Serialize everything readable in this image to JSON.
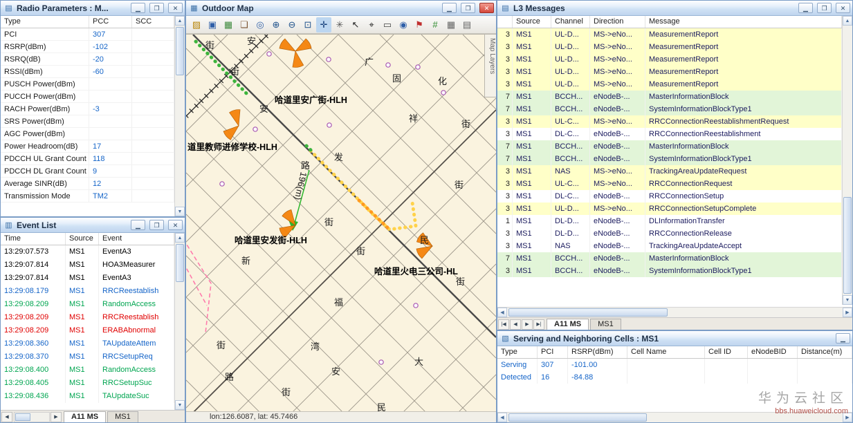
{
  "chrome": {
    "minimize_glyph": "▁",
    "restore_glyph": "❐",
    "close_glyph": "✕",
    "arrow_up": "▲",
    "arrow_down": "▼",
    "arrow_left": "◀",
    "arrow_right": "▶",
    "tab_nav": [
      "|◀",
      "◀",
      "▶",
      "▶|"
    ],
    "icons": {
      "radio": "▤",
      "events": "▥",
      "map": "▦",
      "l3": "▤",
      "serving": "▧"
    }
  },
  "radio": {
    "title": "Radio Parameters : M...",
    "columns": [
      "Type",
      "PCC",
      "SCC"
    ],
    "rows": [
      {
        "type": "PCI",
        "pcc": "307",
        "scc": ""
      },
      {
        "type": "RSRP(dBm)",
        "pcc": "-102",
        "scc": ""
      },
      {
        "type": "RSRQ(dB)",
        "pcc": "-20",
        "scc": ""
      },
      {
        "type": "RSSI(dBm)",
        "pcc": "-60",
        "scc": ""
      },
      {
        "type": "PUSCH Power(dBm)",
        "pcc": "",
        "scc": ""
      },
      {
        "type": "PUCCH Power(dBm)",
        "pcc": "",
        "scc": ""
      },
      {
        "type": "RACH Power(dBm)",
        "pcc": "-3",
        "scc": ""
      },
      {
        "type": "SRS Power(dBm)",
        "pcc": "",
        "scc": ""
      },
      {
        "type": "AGC Power(dBm)",
        "pcc": "",
        "scc": ""
      },
      {
        "type": "Power Headroom(dB)",
        "pcc": "17",
        "scc": ""
      },
      {
        "type": "PDCCH UL Grant Count",
        "pcc": "118",
        "scc": ""
      },
      {
        "type": "PDCCH DL Grant Count",
        "pcc": "9",
        "scc": ""
      },
      {
        "type": "Average SINR(dB)",
        "pcc": "12",
        "scc": ""
      },
      {
        "type": "Transmission Mode",
        "pcc": "TM2",
        "scc": ""
      }
    ]
  },
  "events": {
    "title": "Event List",
    "columns": [
      "Time",
      "Source",
      "Event"
    ],
    "rows": [
      {
        "time": "13:29:07.573",
        "source": "MS1",
        "event": "EventA3",
        "color": "#000000"
      },
      {
        "time": "13:29:07.814",
        "source": "MS1",
        "event": "HOA3Measurer",
        "color": "#000000"
      },
      {
        "time": "13:29:07.814",
        "source": "MS1",
        "event": "EventA3",
        "color": "#000000"
      },
      {
        "time": "13:29:08.179",
        "source": "MS1",
        "event": "RRCReestablish",
        "color": "#1464c8"
      },
      {
        "time": "13:29:08.209",
        "source": "MS1",
        "event": "RandomAccess",
        "color": "#00a550"
      },
      {
        "time": "13:29:08.209",
        "source": "MS1",
        "event": "RRCReestablish",
        "color": "#e00000"
      },
      {
        "time": "13:29:08.209",
        "source": "MS1",
        "event": "ERABAbnormal",
        "color": "#e00000"
      },
      {
        "time": "13:29:08.360",
        "source": "MS1",
        "event": "TAUpdateAttem",
        "color": "#1464c8"
      },
      {
        "time": "13:29:08.370",
        "source": "MS1",
        "event": "RRCSetupReq",
        "color": "#1464c8"
      },
      {
        "time": "13:29:08.400",
        "source": "MS1",
        "event": "RandomAccess",
        "color": "#00a550"
      },
      {
        "time": "13:29:08.405",
        "source": "MS1",
        "event": "RRCSetupSuc",
        "color": "#00a550"
      },
      {
        "time": "13:29:08.436",
        "source": "MS1",
        "event": "TAUpdateSuc",
        "color": "#00a550"
      }
    ],
    "tabs": [
      "A11 MS",
      "MS1"
    ]
  },
  "map": {
    "title": "Outdoor Map",
    "layers_tab": "Map Layers",
    "status": "lon:126.6087, lat: 45.7466",
    "distance_label": "196(m)",
    "toolbar": [
      {
        "name": "open-button",
        "glyph": "▨",
        "color": "#b8860b",
        "bg": ""
      },
      {
        "name": "save-button",
        "glyph": "▣",
        "color": "#2f5fa8",
        "bg": ""
      },
      {
        "name": "export-image-button",
        "glyph": "▦",
        "color": "#3e8a3e",
        "bg": ""
      },
      {
        "name": "layers-button",
        "glyph": "❏",
        "color": "#7a5230",
        "bg": ""
      },
      {
        "name": "find-button",
        "glyph": "◎",
        "color": "#2f5fa8",
        "bg": ""
      },
      {
        "name": "zoom-in-button",
        "glyph": "⊕",
        "color": "#1c4f8a",
        "bg": ""
      },
      {
        "name": "zoom-out-button",
        "glyph": "⊖",
        "color": "#1c4f8a",
        "bg": ""
      },
      {
        "name": "zoom-window-button",
        "glyph": "⊡",
        "color": "#1c4f8a",
        "bg": ""
      },
      {
        "name": "pan-button",
        "glyph": "✛",
        "color": "#123c78",
        "bg": "#bcd6f0"
      },
      {
        "name": "full-extent-button",
        "glyph": "✳",
        "color": "#555555",
        "bg": ""
      },
      {
        "name": "pointer-button",
        "glyph": "↖",
        "color": "#222222",
        "bg": ""
      },
      {
        "name": "track-pointer-button",
        "glyph": "⌖",
        "color": "#222222",
        "bg": ""
      },
      {
        "name": "measure-button",
        "glyph": "▭",
        "color": "#444444",
        "bg": ""
      },
      {
        "name": "globe-button",
        "glyph": "◉",
        "color": "#2f5fa8",
        "bg": ""
      },
      {
        "name": "flag-button",
        "glyph": "⚑",
        "color": "#c03030",
        "bg": ""
      },
      {
        "name": "grid-button",
        "glyph": "#",
        "color": "#2e8b2e",
        "bg": ""
      },
      {
        "name": "mesh-button",
        "glyph": "▦",
        "color": "#666666",
        "bg": ""
      },
      {
        "name": "report-button",
        "glyph": "▤",
        "color": "#666666",
        "bg": ""
      }
    ],
    "site_labels": [
      "哈道里安广街-HLH",
      "道里教师进修学校-HLH",
      "哈道里安发街-HLH",
      "哈道里火电三公司-HL"
    ],
    "street_labels": [
      "街",
      "安",
      "街",
      "广",
      "固",
      "化",
      "安",
      "祥",
      "街",
      "发",
      "路",
      "街",
      "街",
      "街",
      "新",
      "民",
      "街",
      "福",
      "湾",
      "安",
      "大",
      "街",
      "路",
      "街",
      "民"
    ]
  },
  "l3": {
    "title": "L3 Messages",
    "columns": [
      "Source",
      "Channel",
      "Direction",
      "Message"
    ],
    "rows": [
      {
        "num": "3",
        "source": "MS1",
        "channel": "UL-D...",
        "direction": "MS->eNo...",
        "message": "MeasurementReport",
        "bg": "#ffffc8"
      },
      {
        "num": "3",
        "source": "MS1",
        "channel": "UL-D...",
        "direction": "MS->eNo...",
        "message": "MeasurementReport",
        "bg": "#ffffc8"
      },
      {
        "num": "3",
        "source": "MS1",
        "channel": "UL-D...",
        "direction": "MS->eNo...",
        "message": "MeasurementReport",
        "bg": "#ffffc8"
      },
      {
        "num": "3",
        "source": "MS1",
        "channel": "UL-D...",
        "direction": "MS->eNo...",
        "message": "MeasurementReport",
        "bg": "#ffffc8"
      },
      {
        "num": "3",
        "source": "MS1",
        "channel": "UL-D...",
        "direction": "MS->eNo...",
        "message": "MeasurementReport",
        "bg": "#ffffc8"
      },
      {
        "num": "7",
        "source": "MS1",
        "channel": "BCCH...",
        "direction": "eNodeB-...",
        "message": "MasterInformationBlock",
        "bg": "#e2f5d8"
      },
      {
        "num": "7",
        "source": "MS1",
        "channel": "BCCH...",
        "direction": "eNodeB-...",
        "message": "SystemInformationBlockType1",
        "bg": "#e2f5d8"
      },
      {
        "num": "3",
        "source": "MS1",
        "channel": "UL-C...",
        "direction": "MS->eNo...",
        "message": "RRCConnectionReestablishmentRequest",
        "bg": "#ffffc8"
      },
      {
        "num": "3",
        "source": "MS1",
        "channel": "DL-C...",
        "direction": "eNodeB-...",
        "message": "RRCConnectionReestablishment",
        "bg": "#ffffff"
      },
      {
        "num": "7",
        "source": "MS1",
        "channel": "BCCH...",
        "direction": "eNodeB-...",
        "message": "MasterInformationBlock",
        "bg": "#e2f5d8"
      },
      {
        "num": "7",
        "source": "MS1",
        "channel": "BCCH...",
        "direction": "eNodeB-...",
        "message": "SystemInformationBlockType1",
        "bg": "#e2f5d8"
      },
      {
        "num": "3",
        "source": "MS1",
        "channel": "NAS",
        "direction": "MS->eNo...",
        "message": "TrackingAreaUpdateRequest",
        "bg": "#ffffc8"
      },
      {
        "num": "3",
        "source": "MS1",
        "channel": "UL-C...",
        "direction": "MS->eNo...",
        "message": "RRCConnectionRequest",
        "bg": "#ffffc8"
      },
      {
        "num": "3",
        "source": "MS1",
        "channel": "DL-C...",
        "direction": "eNodeB-...",
        "message": "RRCConnectionSetup",
        "bg": "#ffffff"
      },
      {
        "num": "3",
        "source": "MS1",
        "channel": "UL-D...",
        "direction": "MS->eNo...",
        "message": "RRCConnectionSetupComplete",
        "bg": "#ffffc8"
      },
      {
        "num": "1",
        "source": "MS1",
        "channel": "DL-D...",
        "direction": "eNodeB-...",
        "message": "DLInformationTransfer",
        "bg": "#ffffff"
      },
      {
        "num": "3",
        "source": "MS1",
        "channel": "DL-D...",
        "direction": "eNodeB-...",
        "message": "RRCConnectionRelease",
        "bg": "#ffffff"
      },
      {
        "num": "3",
        "source": "MS1",
        "channel": "NAS",
        "direction": "eNodeB-...",
        "message": "TrackingAreaUpdateAccept",
        "bg": "#ffffff"
      },
      {
        "num": "7",
        "source": "MS1",
        "channel": "BCCH...",
        "direction": "eNodeB-...",
        "message": "MasterInformationBlock",
        "bg": "#e2f5d8"
      },
      {
        "num": "3",
        "source": "MS1",
        "channel": "BCCH...",
        "direction": "eNodeB-...",
        "message": "SystemInformationBlockType1",
        "bg": "#e2f5d8"
      }
    ],
    "tabs": [
      "A11 MS",
      "MS1"
    ]
  },
  "serving": {
    "title": "Serving and Neighboring Cells : MS1",
    "columns": [
      "Type",
      "PCI",
      "RSRP(dBm)",
      "Cell Name",
      "Cell ID",
      "eNodeBID",
      "Distance(m)"
    ],
    "rows": [
      {
        "type": "Serving",
        "pci": "307",
        "rsrp": "-101.00",
        "cell_name": "",
        "cell_id": "",
        "enodebid": "",
        "distance": ""
      },
      {
        "type": "Detected",
        "pci": "16",
        "rsrp": "-84.88",
        "cell_name": "",
        "cell_id": "",
        "enodebid": "",
        "distance": ""
      }
    ]
  },
  "watermark": {
    "line1": "华为云社区",
    "line2": "bbs.huaweicloud.com"
  }
}
